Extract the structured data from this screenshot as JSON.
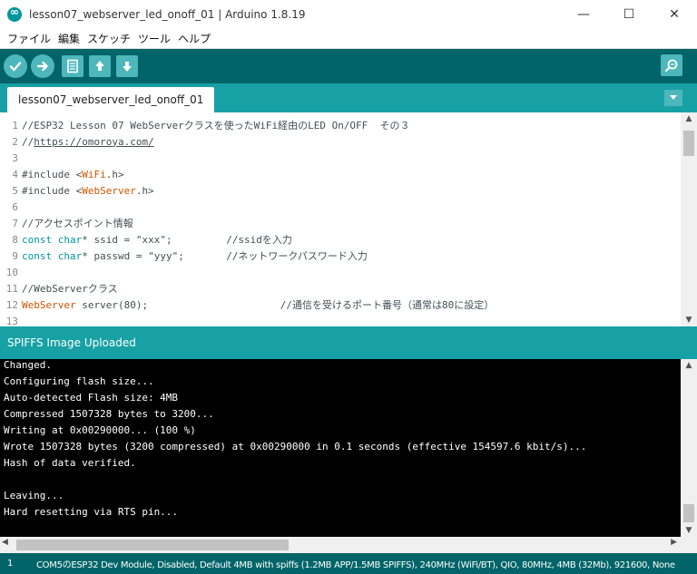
{
  "window": {
    "title": "lesson07_webserver_led_onoff_01 | Arduino 1.8.19",
    "minimize": "—",
    "maximize": "☐",
    "close": "✕"
  },
  "menu": {
    "items": [
      {
        "label": "ファイル"
      },
      {
        "label": "編集"
      },
      {
        "label": "スケッチ"
      },
      {
        "label": "ツール"
      },
      {
        "label": "ヘルプ"
      }
    ]
  },
  "toolbar": {
    "icons": [
      "verify-icon",
      "upload-icon",
      "new-icon",
      "open-icon",
      "save-icon",
      "serial-monitor-icon"
    ]
  },
  "tabs": [
    {
      "label": "lesson07_webserver_led_onoff_01"
    }
  ],
  "editor": {
    "lines": [
      {
        "no": "1",
        "parts": [
          {
            "t": "//ESP32 Lesson 07 WebServerクラスを使ったWiFi経由のLED On/OFF  その３",
            "c": "cm"
          }
        ]
      },
      {
        "no": "2",
        "parts": [
          {
            "t": "//",
            "c": "cm"
          },
          {
            "t": "https://omoroya.com/",
            "c": "link"
          }
        ]
      },
      {
        "no": "3",
        "parts": []
      },
      {
        "no": "4",
        "parts": [
          {
            "t": "#include <",
            "c": "code"
          },
          {
            "t": "WiFi",
            "c": "kw-orange"
          },
          {
            "t": ".h>",
            "c": "code"
          }
        ]
      },
      {
        "no": "5",
        "parts": [
          {
            "t": "#include <",
            "c": "code"
          },
          {
            "t": "WebServer",
            "c": "kw-orange"
          },
          {
            "t": ".h>",
            "c": "code"
          }
        ]
      },
      {
        "no": "6",
        "parts": []
      },
      {
        "no": "7",
        "parts": [
          {
            "t": "//アクセスポイント情報",
            "c": "cm"
          }
        ]
      },
      {
        "no": "8",
        "parts": [
          {
            "t": "const",
            "c": "kw-teal"
          },
          {
            "t": " ",
            "c": "code"
          },
          {
            "t": "char",
            "c": "kw-teal"
          },
          {
            "t": "* ssid = \"xxx\";         //ssidを入力",
            "c": "code"
          }
        ]
      },
      {
        "no": "9",
        "parts": [
          {
            "t": "const",
            "c": "kw-teal"
          },
          {
            "t": " ",
            "c": "code"
          },
          {
            "t": "char",
            "c": "kw-teal"
          },
          {
            "t": "* passwd = \"yyy\";       //ネットワークパスワード入力",
            "c": "code"
          }
        ]
      },
      {
        "no": "10",
        "parts": []
      },
      {
        "no": "11",
        "parts": [
          {
            "t": "//WebServerクラス",
            "c": "cm"
          }
        ]
      },
      {
        "no": "12",
        "parts": [
          {
            "t": "WebServer",
            "c": "kw-orange"
          },
          {
            "t": " server(80);                      //通信を受けるポート番号（通常は80に設定）",
            "c": "code"
          }
        ]
      },
      {
        "no": "13",
        "parts": []
      }
    ]
  },
  "status": {
    "message": "SPIFFS Image Uploaded"
  },
  "console": {
    "lines": [
      "Changed.",
      "Configuring flash size...",
      "Auto-detected Flash size: 4MB",
      "Compressed 1507328 bytes to 3200...",
      "Writing at 0x00290000... (100 %)",
      "Wrote 1507328 bytes (3200 compressed) at 0x00290000 in 0.1 seconds (effective 154597.6 kbit/s)...",
      "Hash of data verified.",
      "",
      "Leaving...",
      "Hard resetting via RTS pin..."
    ]
  },
  "footer": {
    "line": "1",
    "board": "COM5のESP32 Dev Module, Disabled, Default 4MB with spiffs (1.2MB APP/1.5MB SPIFFS), 240MHz (WiFi/BT), QIO, 80MHz, 4MB (32Mb), 921600, None"
  },
  "colors": {
    "toolbar_bg": "#006468",
    "tab_bar_bg": "#17a1a5",
    "button_bg": "#4db7bb",
    "keyword_orange": "#d35400",
    "keyword_teal": "#00979c",
    "console_bg": "#000000"
  }
}
